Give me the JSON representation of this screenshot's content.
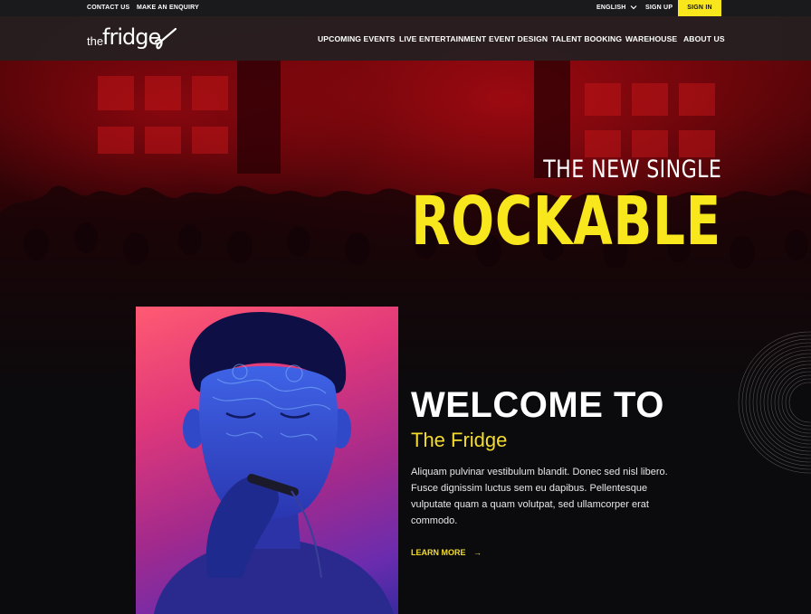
{
  "topbar": {
    "contact": "CONTACT US",
    "enquiry": "MAKE AN ENQUIRY",
    "language": "ENGLISH",
    "signup": "SIGN UP",
    "signin": "SIGN IN"
  },
  "brand": {
    "the": "the",
    "fridge": "fridge"
  },
  "nav": {
    "items": [
      "UPCOMING EVENTS",
      "LIVE ENTERTAINMENT",
      "EVENT DESIGN",
      "TALENT BOOKING",
      "WAREHOUSE",
      "ABOUT US"
    ]
  },
  "hero": {
    "kicker": "THE NEW SINGLE",
    "headline": "ROCKABLE"
  },
  "welcome": {
    "title": "WELCOME TO",
    "subtitle": "The Fridge",
    "body": "Aliquam pulvinar vestibulum blandit. Donec sed nisl libero. Fusce dignissim luctus sem eu dapibus. Pellentesque vulputate quam a quam volutpat, sed ullamcorper erat commodo.",
    "cta": "LEARN MORE",
    "cta_arrow": "→"
  },
  "colors": {
    "accent": "#f9e71e",
    "topbar": "#1a1a1c",
    "hero_red": "#8a0a10"
  },
  "icons": {
    "language_chevron": "chevron-down-icon",
    "cta_arrow": "arrow-right-icon",
    "vinyl": "vinyl-record-icon"
  }
}
